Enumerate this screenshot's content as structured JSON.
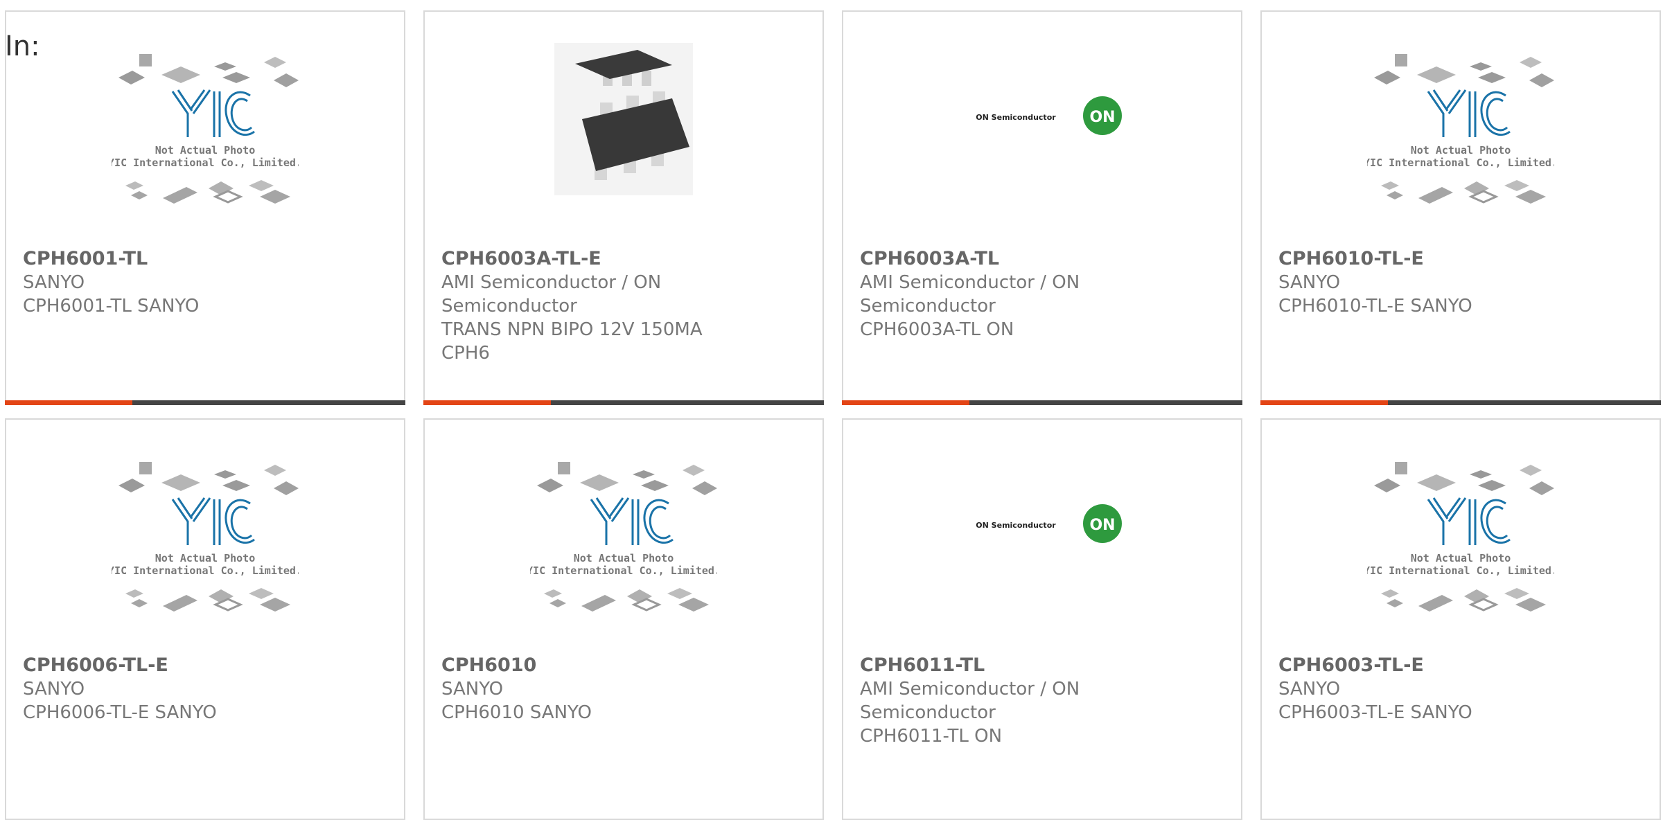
{
  "header": {
    "label": "In:"
  },
  "colors": {
    "accent": "#e34516",
    "bar": "#444444",
    "border": "#d9d9d9",
    "text": "#666666",
    "onlogo": "#2e9a3e"
  },
  "placeholder": {
    "line1": "Not Actual Photo",
    "line2": "YIC International Co., Limited.",
    "logo": "YIC"
  },
  "brand_logo": {
    "text": "ON Semiconductor",
    "badge": "ON"
  },
  "products": [
    {
      "pn": "CPH6001-TL",
      "maker": [
        "SANYO"
      ],
      "desc": [
        "CPH6001-TL SANYO"
      ],
      "image": "yic-placeholder"
    },
    {
      "pn": "CPH6003A-TL-E",
      "maker": [
        "AMI Semiconductor / ON",
        "Semiconductor"
      ],
      "desc": [
        "TRANS NPN BIPO 12V 150MA",
        "CPH6"
      ],
      "image": "sot-23-6-chip"
    },
    {
      "pn": "CPH6003A-TL",
      "maker": [
        "AMI Semiconductor / ON",
        "Semiconductor"
      ],
      "desc": [
        "CPH6003A-TL ON"
      ],
      "image": "on-semi-logo"
    },
    {
      "pn": "CPH6010-TL-E",
      "maker": [
        "SANYO"
      ],
      "desc": [
        "CPH6010-TL-E SANYO"
      ],
      "image": "yic-placeholder"
    },
    {
      "pn": "CPH6006-TL-E",
      "maker": [
        "SANYO"
      ],
      "desc": [
        "CPH6006-TL-E SANYO"
      ],
      "image": "yic-placeholder"
    },
    {
      "pn": "CPH6010",
      "maker": [
        "SANYO"
      ],
      "desc": [
        "CPH6010 SANYO"
      ],
      "image": "yic-placeholder"
    },
    {
      "pn": "CPH6011-TL",
      "maker": [
        "AMI Semiconductor / ON",
        "Semiconductor"
      ],
      "desc": [
        "CPH6011-TL ON"
      ],
      "image": "on-semi-logo"
    },
    {
      "pn": "CPH6003-TL-E",
      "maker": [
        "SANYO"
      ],
      "desc": [
        "CPH6003-TL-E SANYO"
      ],
      "image": "yic-placeholder"
    }
  ]
}
